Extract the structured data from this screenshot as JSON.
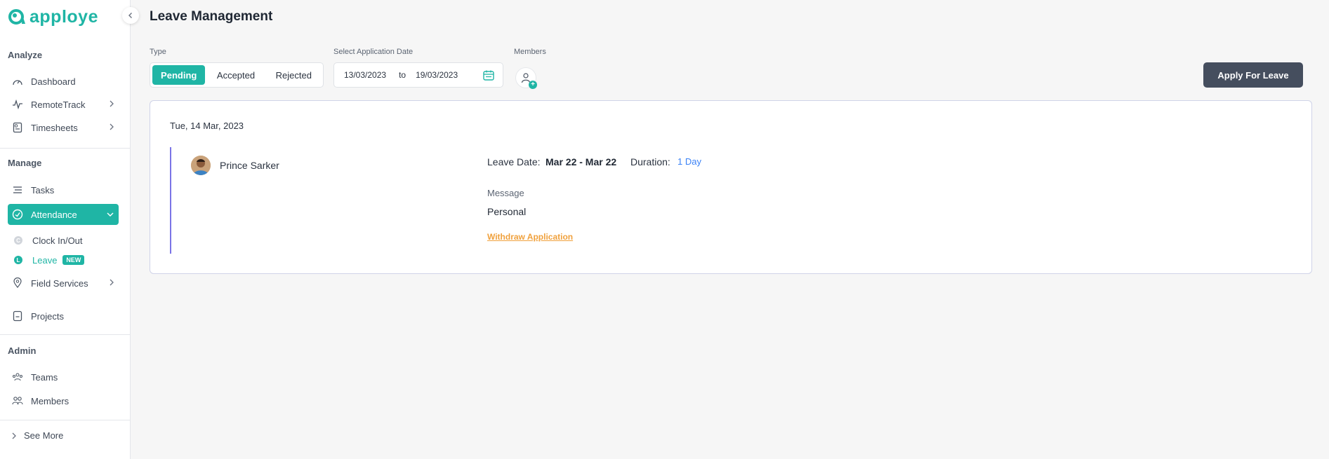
{
  "brand": {
    "name": "apploye",
    "color": "#1fb5a5"
  },
  "sidebar": {
    "sections": {
      "analyze": "Analyze",
      "manage": "Manage",
      "admin": "Admin"
    },
    "items": {
      "dashboard": "Dashboard",
      "remotetrack": "RemoteTrack",
      "timesheets": "Timesheets",
      "tasks": "Tasks",
      "attendance": "Attendance",
      "clock": "Clock In/Out",
      "leave": "Leave",
      "leave_badge": "NEW",
      "field_services": "Field Services",
      "projects": "Projects",
      "teams": "Teams",
      "members": "Members"
    },
    "see_more": "See More"
  },
  "header": {
    "title": "Leave Management"
  },
  "filters": {
    "type_label": "Type",
    "types": [
      "Pending",
      "Accepted",
      "Rejected"
    ],
    "selected_type": "Pending",
    "date_label": "Select Application Date",
    "date_from": "13/03/2023",
    "date_sep": "to",
    "date_to": "19/03/2023",
    "members_label": "Members"
  },
  "apply_button": "Apply For Leave",
  "leave_card": {
    "date": "Tue, 14 Mar, 2023",
    "person": "Prince Sarker",
    "leave_date_label": "Leave Date:",
    "leave_date_value": "Mar 22 - Mar 22",
    "duration_label": "Duration:",
    "duration_value": "1 Day",
    "message_label": "Message",
    "message_value": "Personal",
    "withdraw_label": "Withdraw Application"
  }
}
